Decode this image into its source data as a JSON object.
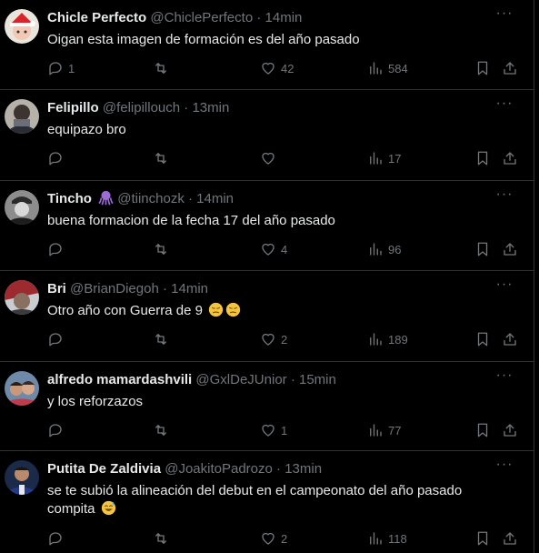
{
  "tweets": [
    {
      "name": "Chicle Perfecto",
      "handle": "@ChiclePerfecto",
      "time": "14min",
      "text": "Oigan esta imagen de formación es del año pasado",
      "text2": "",
      "replies": "1",
      "likes": "42",
      "views": "584"
    },
    {
      "name": "Felipillo",
      "handle": "@felipillouch",
      "time": "13min",
      "text": "equipazo bro",
      "text2": "",
      "replies": "",
      "likes": "",
      "views": "17"
    },
    {
      "name": "Tincho",
      "handle": "@tiinchozk",
      "time": "14min",
      "text": "buena formacion de la fecha 17 del año pasado",
      "text2": "",
      "replies": "",
      "likes": "4",
      "views": "96"
    },
    {
      "name": "Bri",
      "handle": "@BrianDiegoh",
      "time": "14min",
      "text": "Otro año con Guerra de 9",
      "text2": "",
      "replies": "",
      "likes": "2",
      "views": "189"
    },
    {
      "name": "alfredo mamardashvili",
      "handle": "@GxlDeJUnior",
      "time": "15min",
      "text": "y los reforzazos",
      "text2": "",
      "replies": "",
      "likes": "1",
      "views": "77"
    },
    {
      "name": "Putita De Zaldivia",
      "handle": "@JoakitoPadrozo",
      "time": "13min",
      "text": "se te subió la alineación del debut en el campeonato del año pasado",
      "text2": "compita",
      "replies": "",
      "likes": "2",
      "views": "118"
    }
  ],
  "separator": "·",
  "more_label": "···",
  "colors": {
    "background": "#000000",
    "text": "#e7e9ea",
    "muted": "#71767b",
    "border": "#2f3336"
  },
  "icons": [
    "reply-icon",
    "retweet-icon",
    "like-icon",
    "views-icon",
    "bookmark-icon",
    "share-icon",
    "more-icon"
  ]
}
